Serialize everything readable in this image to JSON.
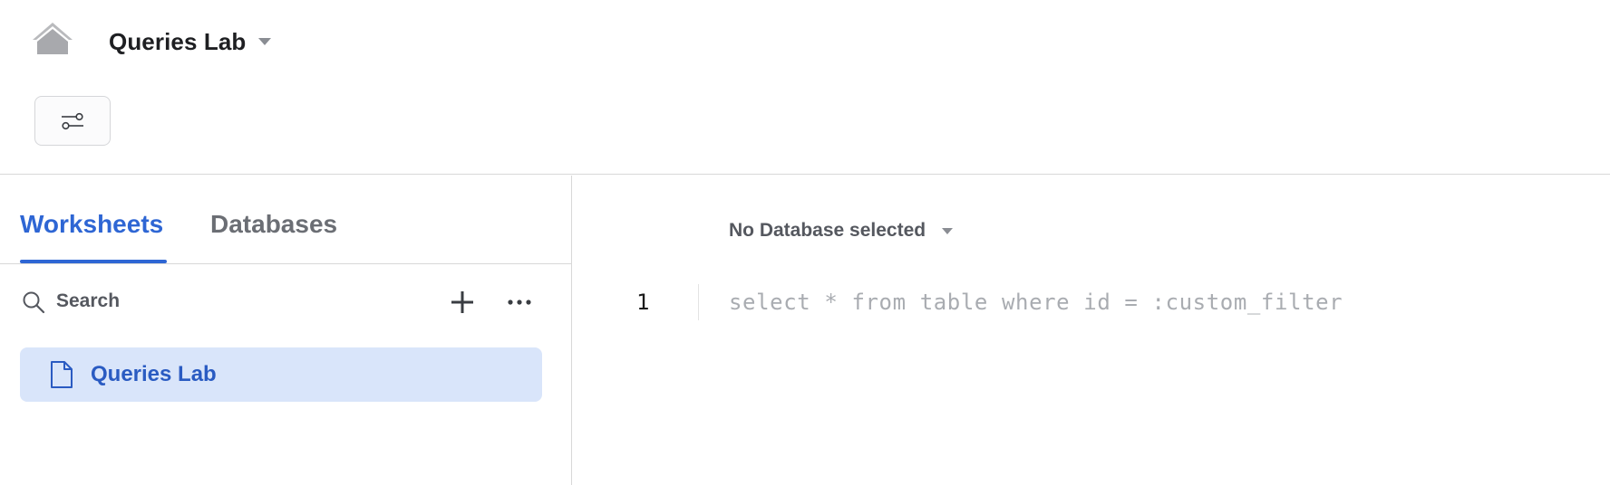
{
  "header": {
    "title": "Queries Lab",
    "home_icon": "home-icon",
    "filter_icon": "sliders-icon"
  },
  "sidebar": {
    "tabs": [
      {
        "label": "Worksheets",
        "active": true
      },
      {
        "label": "Databases",
        "active": false
      }
    ],
    "search": {
      "placeholder": "Search",
      "value": ""
    },
    "items": [
      {
        "label": "Queries Lab",
        "icon": "document-icon",
        "selected": true
      }
    ]
  },
  "editor": {
    "database_label": "No Database selected",
    "lines": [
      {
        "number": "1",
        "text": "select * from table where id = :custom_filter"
      }
    ]
  },
  "colors": {
    "accent": "#2e66d4",
    "selected_bg": "#d9e5fa",
    "border": "#d8d8d8"
  }
}
